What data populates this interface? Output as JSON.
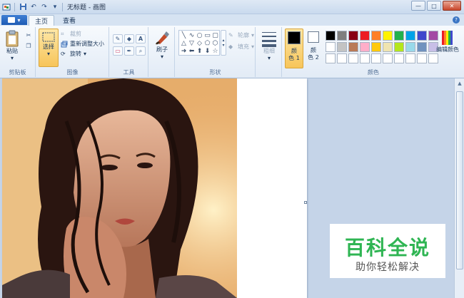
{
  "window": {
    "title": "无标题 - 画图",
    "controls": {
      "minimize": "—",
      "maximize": "□",
      "close": "✕"
    }
  },
  "quick_access": {
    "icons": [
      "paint-app-icon",
      "save-icon",
      "undo-icon",
      "redo-icon",
      "customize-dropdown-icon"
    ]
  },
  "tabs": [
    {
      "label": "主页",
      "active": true
    },
    {
      "label": "查看",
      "active": false
    }
  ],
  "help_label": "?",
  "ribbon": {
    "clipboard": {
      "label": "剪贴板",
      "paste": "粘贴",
      "cut_icon": "scissors-icon",
      "copy_icon": "copy-icon"
    },
    "image": {
      "label": "图像",
      "select": "选择",
      "crop": "裁剪",
      "resize": "重新调整大小",
      "rotate": "旋转"
    },
    "tools": {
      "label": "工具",
      "pencil": "✎",
      "fill": "◆",
      "text": "A",
      "eraser": "▭",
      "picker": "✒",
      "magnifier": "⌕"
    },
    "brushes": {
      "label": "刷子"
    },
    "shapes": {
      "label": "形状",
      "outline": "轮廓",
      "fill": "填充",
      "glyphs": [
        "╲",
        "∿",
        "○",
        "▭",
        "▢",
        "△",
        "▽",
        "◇",
        "⬠",
        "⬡",
        "➜",
        "⬅",
        "⬆",
        "⬇",
        "☆"
      ]
    },
    "size": {
      "label": "粗细"
    },
    "colors": {
      "label": "颜色",
      "color1_line1": "颜",
      "color1_line2": "色 1",
      "color2_line1": "颜",
      "color2_line2": "色 2",
      "edit_colors": "编辑颜色",
      "color1": "#000000",
      "color2": "#ffffff",
      "palette": [
        "#000000",
        "#7f7f7f",
        "#880015",
        "#ed1c24",
        "#ff7f27",
        "#fff200",
        "#22b14c",
        "#00a2e8",
        "#3f48cc",
        "#a349a4",
        "#ffffff",
        "#c3c3c3",
        "#b97a57",
        "#ffaec9",
        "#ffc90e",
        "#efe4b0",
        "#b5e61d",
        "#99d9ea",
        "#7092be",
        "#c8bfe7",
        "#ffffff",
        "#ffffff",
        "#ffffff",
        "#ffffff",
        "#ffffff",
        "#ffffff",
        "#ffffff",
        "#ffffff",
        "#ffffff",
        "#ffffff"
      ]
    }
  },
  "watermark": {
    "main": "百科全说",
    "sub": "助你轻松解决"
  }
}
